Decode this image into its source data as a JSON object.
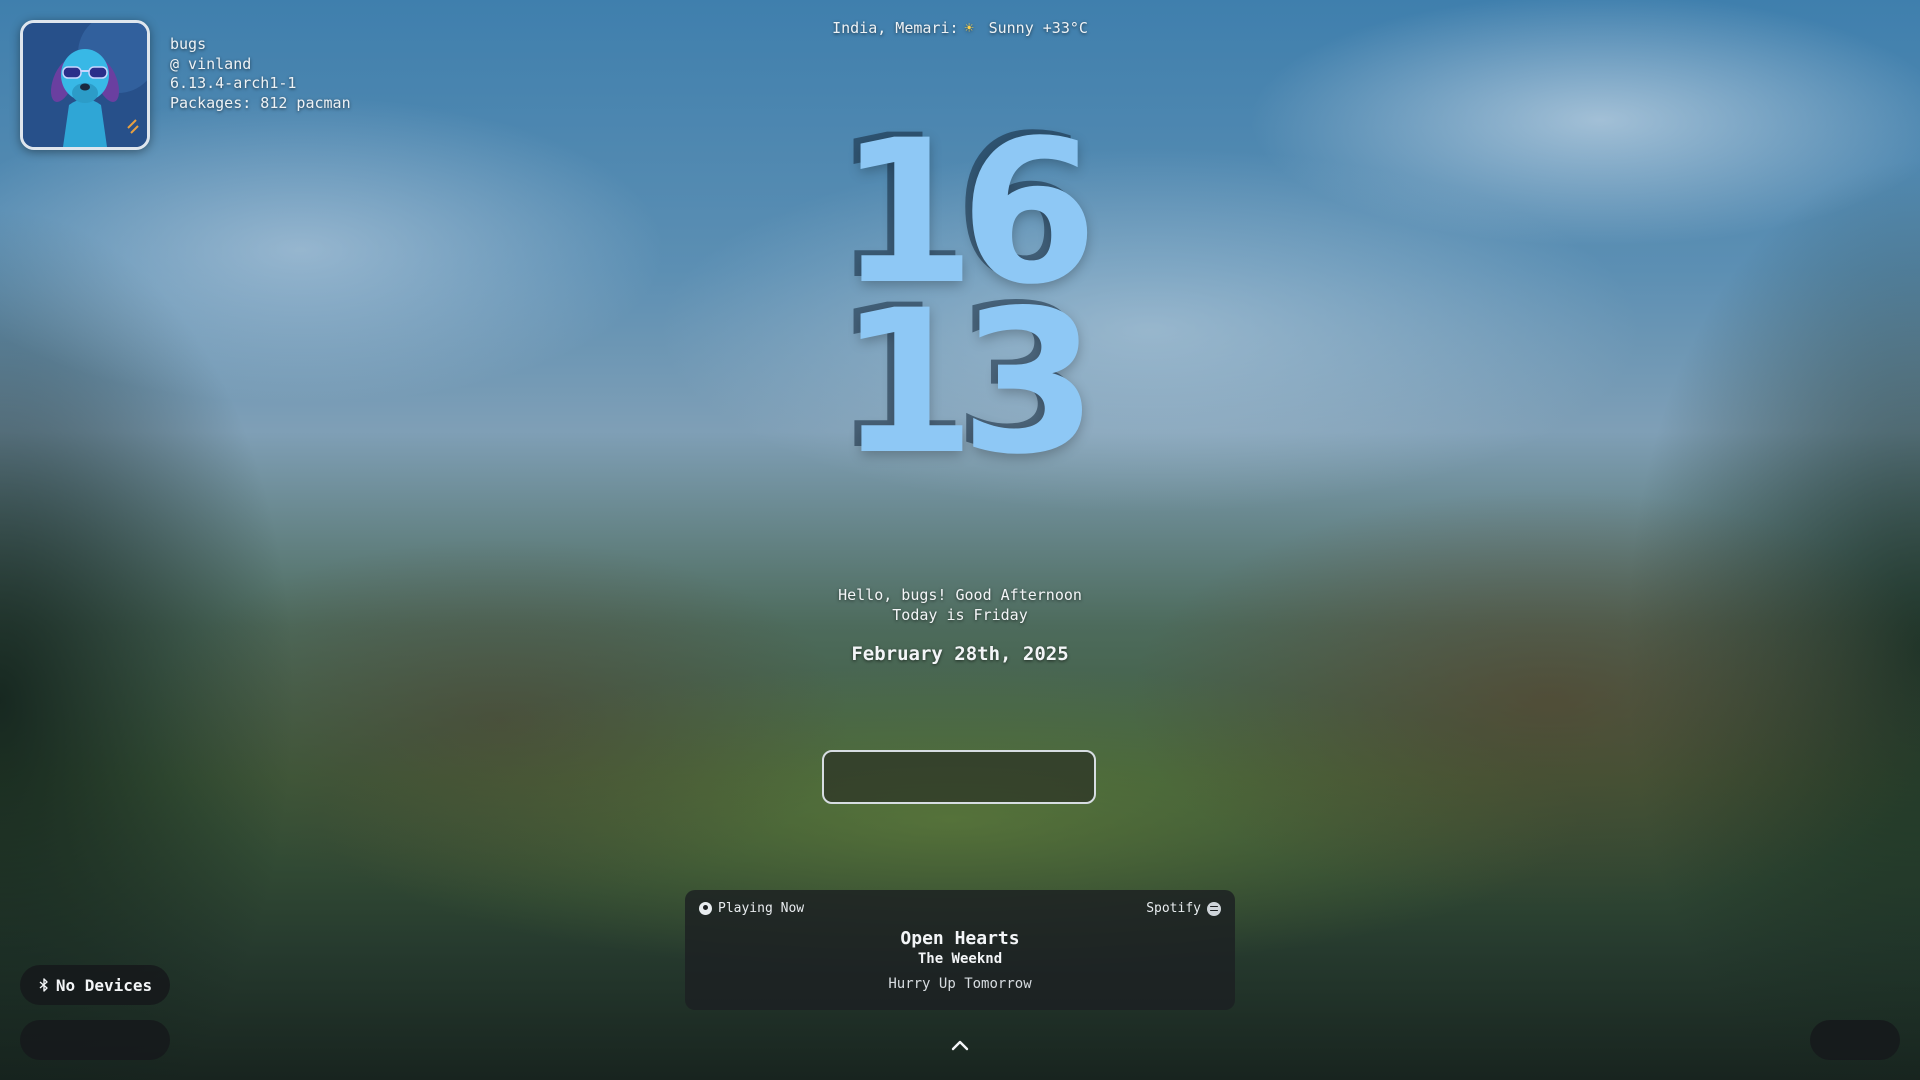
{
  "user": {
    "name": "bugs",
    "host": "@ vinland",
    "kernel": "6.13.4-arch1-1",
    "packages": "Packages: 812 pacman",
    "avatar_icon": "dog-with-sunglasses-avatar"
  },
  "weather": {
    "location": "India, Memari:",
    "icon": "sun-icon",
    "condition": "Sunny +33°C"
  },
  "clock": {
    "hours": "16",
    "minutes": "13",
    "color": "#8ec8f5"
  },
  "greeting": {
    "line1": "Hello, bugs! Good Afternoon",
    "line2": "Today is Friday"
  },
  "date": "February 28th, 2025",
  "password": {
    "placeholder": ""
  },
  "media": {
    "status": "Playing Now",
    "source": "Spotify",
    "title": "Open Hearts",
    "artist": "The Weeknd",
    "album": "Hurry Up Tomorrow"
  },
  "bluetooth": {
    "label": "No Devices",
    "icon": "bluetooth-icon"
  }
}
